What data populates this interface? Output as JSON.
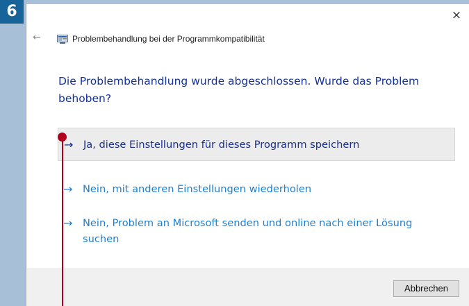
{
  "step": {
    "number": "6"
  },
  "window": {
    "title": "Problembehandlung bei der Programmkompatibilität",
    "back_icon": "back-arrow-icon",
    "close_icon": "close-icon",
    "close_glyph": "×",
    "back_glyph": "←"
  },
  "main": {
    "heading": "Die Problembehandlung wurde abgeschlossen. Wurde das Problem behoben?",
    "options": [
      {
        "label": "Ja, diese Einstellungen für dieses Programm speichern",
        "icon": "arrow-right-icon",
        "glyph": "→"
      },
      {
        "label": "Nein, mit anderen Einstellungen wiederholen",
        "icon": "arrow-right-icon",
        "glyph": "→"
      },
      {
        "label": "Nein, Problem an Microsoft senden und online nach einer Lösung suchen",
        "icon": "arrow-right-icon",
        "glyph": "→"
      }
    ]
  },
  "footer": {
    "cancel_label": "Abbrechen"
  },
  "colors": {
    "step_badge": "#16649a",
    "side_strip": "#a7bfd7",
    "heading": "#13319b",
    "link": "#1f7fd0",
    "callout": "#b0001e"
  }
}
